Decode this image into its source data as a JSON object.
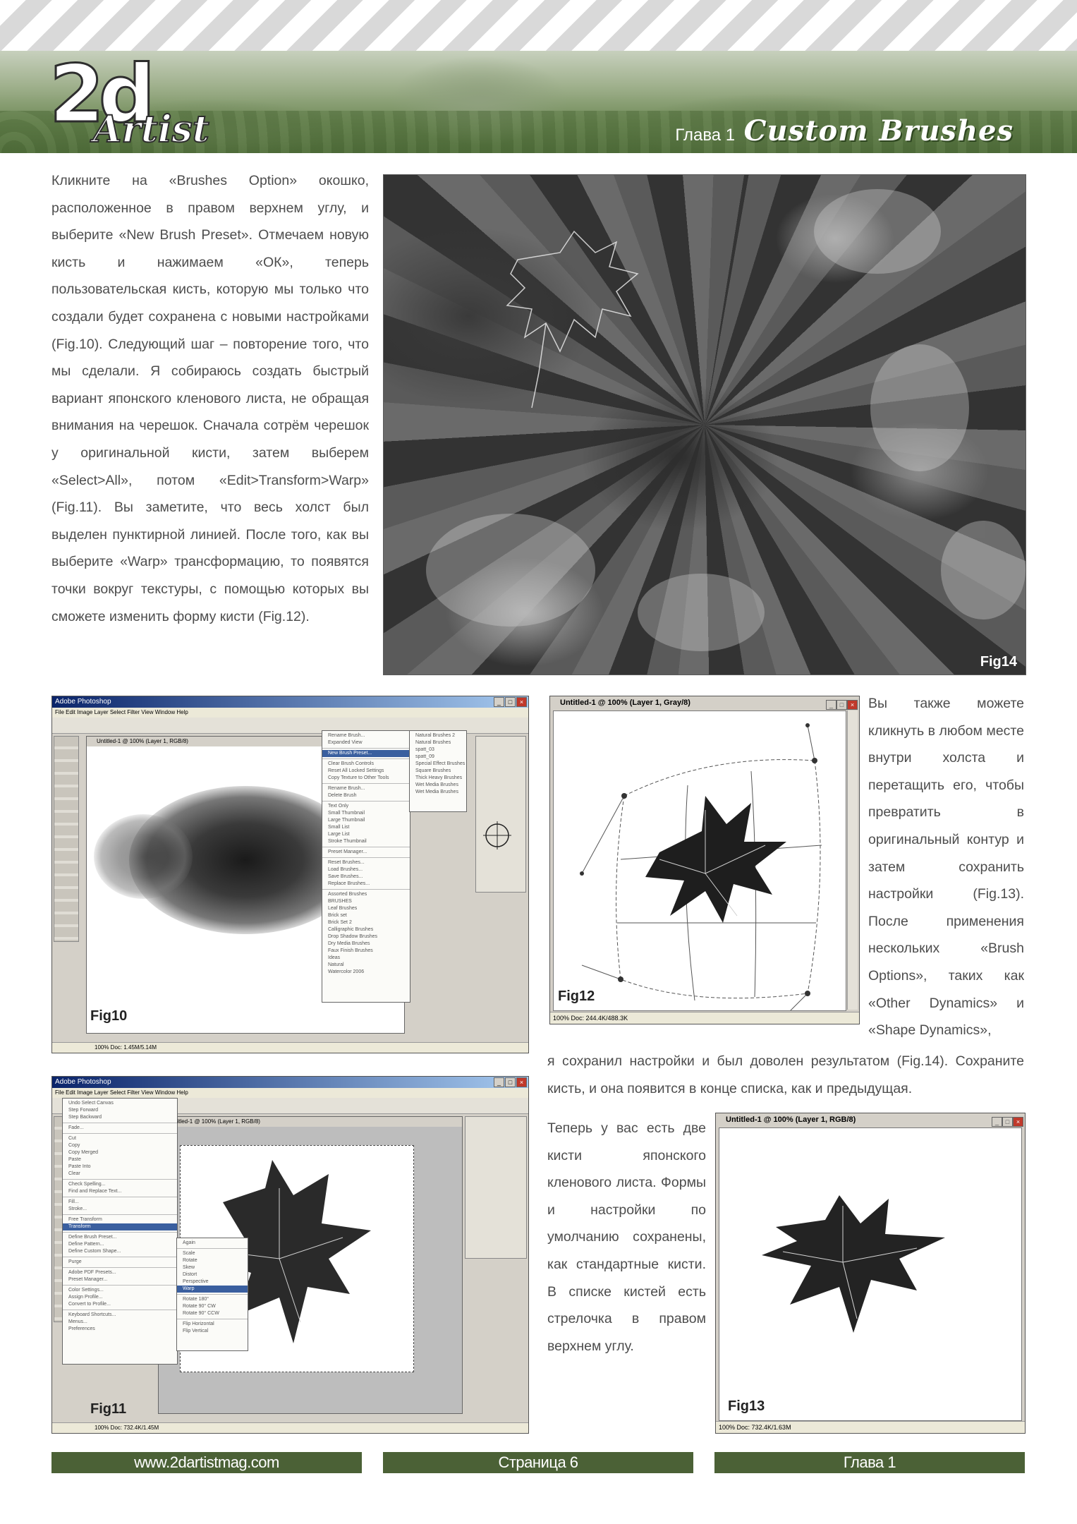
{
  "header": {
    "logo_main": "2d",
    "logo_sub": "Artist",
    "chapter_label": "Глава 1",
    "chapter_title": "Custom Brushes"
  },
  "body": {
    "p1": "Кликните на «Brushes Option» окошко, расположенное в правом верхнем углу, и выберите «New Brush Preset». Отмечаем новую кисть и нажимаем «ОК», теперь пользовательская кисть, которую мы только что создали будет сохранена с новыми настройками (Fig.10). Следующий шаг – повторение того, что мы сделали. Я собираюсь создать быстрый вариант японского кленового листа, не обращая внимания на черешок. Сначала сотрём черешок у оригинальной кисти, затем выберем «Select>All», потом «Edit>Transform>Warp» (Fig.11). Вы заметите, что весь холст был выделен пунктирной линией. После того, как вы выберите «Warp» трансформацию, то появятся точки вокруг текстуры, с помощью которых вы сможете изменить форму кисти (Fig.12).",
    "p2": "Вы также можете кликнуть в любом месте внутри холста и перетащить его, чтобы превратить в оригинальный контур и затем сохранить настройки (Fig.13). После применения нескольких «Brush Options», таких как «Other Dynamics» и «Shape Dynamics»,",
    "p3": "я сохранил настройки и был доволен результатом (Fig.14). Сохраните кисть, и она появится в конце списка, как и предыдущая.",
    "p4": "Теперь у вас есть две кисти японского кленового листа. Формы и настройки по умолчанию сохранены, как стандартные кисти. В списке кистей есть стрелочка в правом верхнем углу."
  },
  "figures": {
    "fig14_label": "Fig14",
    "fig10_label": "Fig10",
    "fig11_label": "Fig11",
    "fig12_label": "Fig12",
    "fig13_label": "Fig13"
  },
  "fig10": {
    "app_title": "Adobe Photoshop",
    "menubar": "File  Edit  Image  Layer  Select  Filter  View  Window  Help",
    "canvas_title": "Untitled-1 @ 100% (Layer 1, RGB/8)",
    "status": "100%     Doc: 1.45M/5.14M",
    "menu_items": [
      "Rename Brush...",
      "Expanded View",
      "New Brush Preset...",
      "Clear Brush Controls",
      "Reset All Locked Settings",
      "Copy Texture to Other Tools",
      "Rename Brush...",
      "Delete Brush",
      "Text Only",
      "Small Thumbnail",
      "Large Thumbnail",
      "Small List",
      "Large List",
      "Stroke Thumbnail",
      "Preset Manager...",
      "Reset Brushes...",
      "Load Brushes...",
      "Save Brushes...",
      "Replace Brushes...",
      "Assorted Brushes",
      "BRUSHES",
      "Leaf Brushes",
      "Brick set",
      "Brick Set 2",
      "Calligraphic Brushes",
      "Drop Shadow Brushes",
      "Dry Media Brushes",
      "Faux Finish Brushes",
      "Ideas",
      "Natural",
      "Watercolor 2006"
    ],
    "submenu_items": [
      "Natural Brushes 2",
      "Natural Brushes",
      "spatt_03",
      "spatt_09",
      "Special Effect Brushes",
      "Square Brushes",
      "Thick Heavy Brushes",
      "Wet Media Brushes",
      "Wet Media Brushes"
    ]
  },
  "fig11": {
    "app_title": "Adobe Photoshop",
    "menubar": "File  Edit  Image  Layer  Select  Filter  View  Window  Help",
    "canvas_title": "Untitled-1 @ 100% (Layer 1, RGB/8)",
    "status": "100%     Doc: 732.4K/1.45M",
    "edit_menu": [
      "Undo Select Canvas",
      "Step Forward",
      "Step Backward",
      "Fade...",
      "Cut",
      "Copy",
      "Copy Merged",
      "Paste",
      "Paste Into",
      "Clear",
      "Check Spelling...",
      "Find and Replace Text...",
      "Fill...",
      "Stroke...",
      "Free Transform",
      "Transform",
      "Define Brush Preset...",
      "Define Pattern...",
      "Define Custom Shape...",
      "Purge",
      "Adobe PDF Presets...",
      "Preset Manager...",
      "Color Settings...",
      "Assign Profile...",
      "Convert to Profile...",
      "Keyboard Shortcuts...",
      "Menus...",
      "Preferences"
    ],
    "transform_menu": [
      "Again",
      "Scale",
      "Rotate",
      "Skew",
      "Distort",
      "Perspective",
      "Warp",
      "Rotate 180°",
      "Rotate 90° CW",
      "Rotate 90° CCW",
      "Flip Horizontal",
      "Flip Vertical"
    ]
  },
  "fig12": {
    "title": "Untitled-1 @ 100% (Layer 1, Gray/8)",
    "status": "100%      Doc: 244.4K/488.3K"
  },
  "fig13": {
    "title": "Untitled-1 @ 100% (Layer 1, RGB/8)",
    "status": "100%      Doc: 732.4K/1.63M"
  },
  "footer": {
    "website": "www.2dartistmag.com",
    "page": "Страница 6",
    "chapter": "Глава 1"
  },
  "colors": {
    "header_green": "#6f8a57",
    "footer_green": "#4b6136",
    "text": "#4d4d4d"
  }
}
